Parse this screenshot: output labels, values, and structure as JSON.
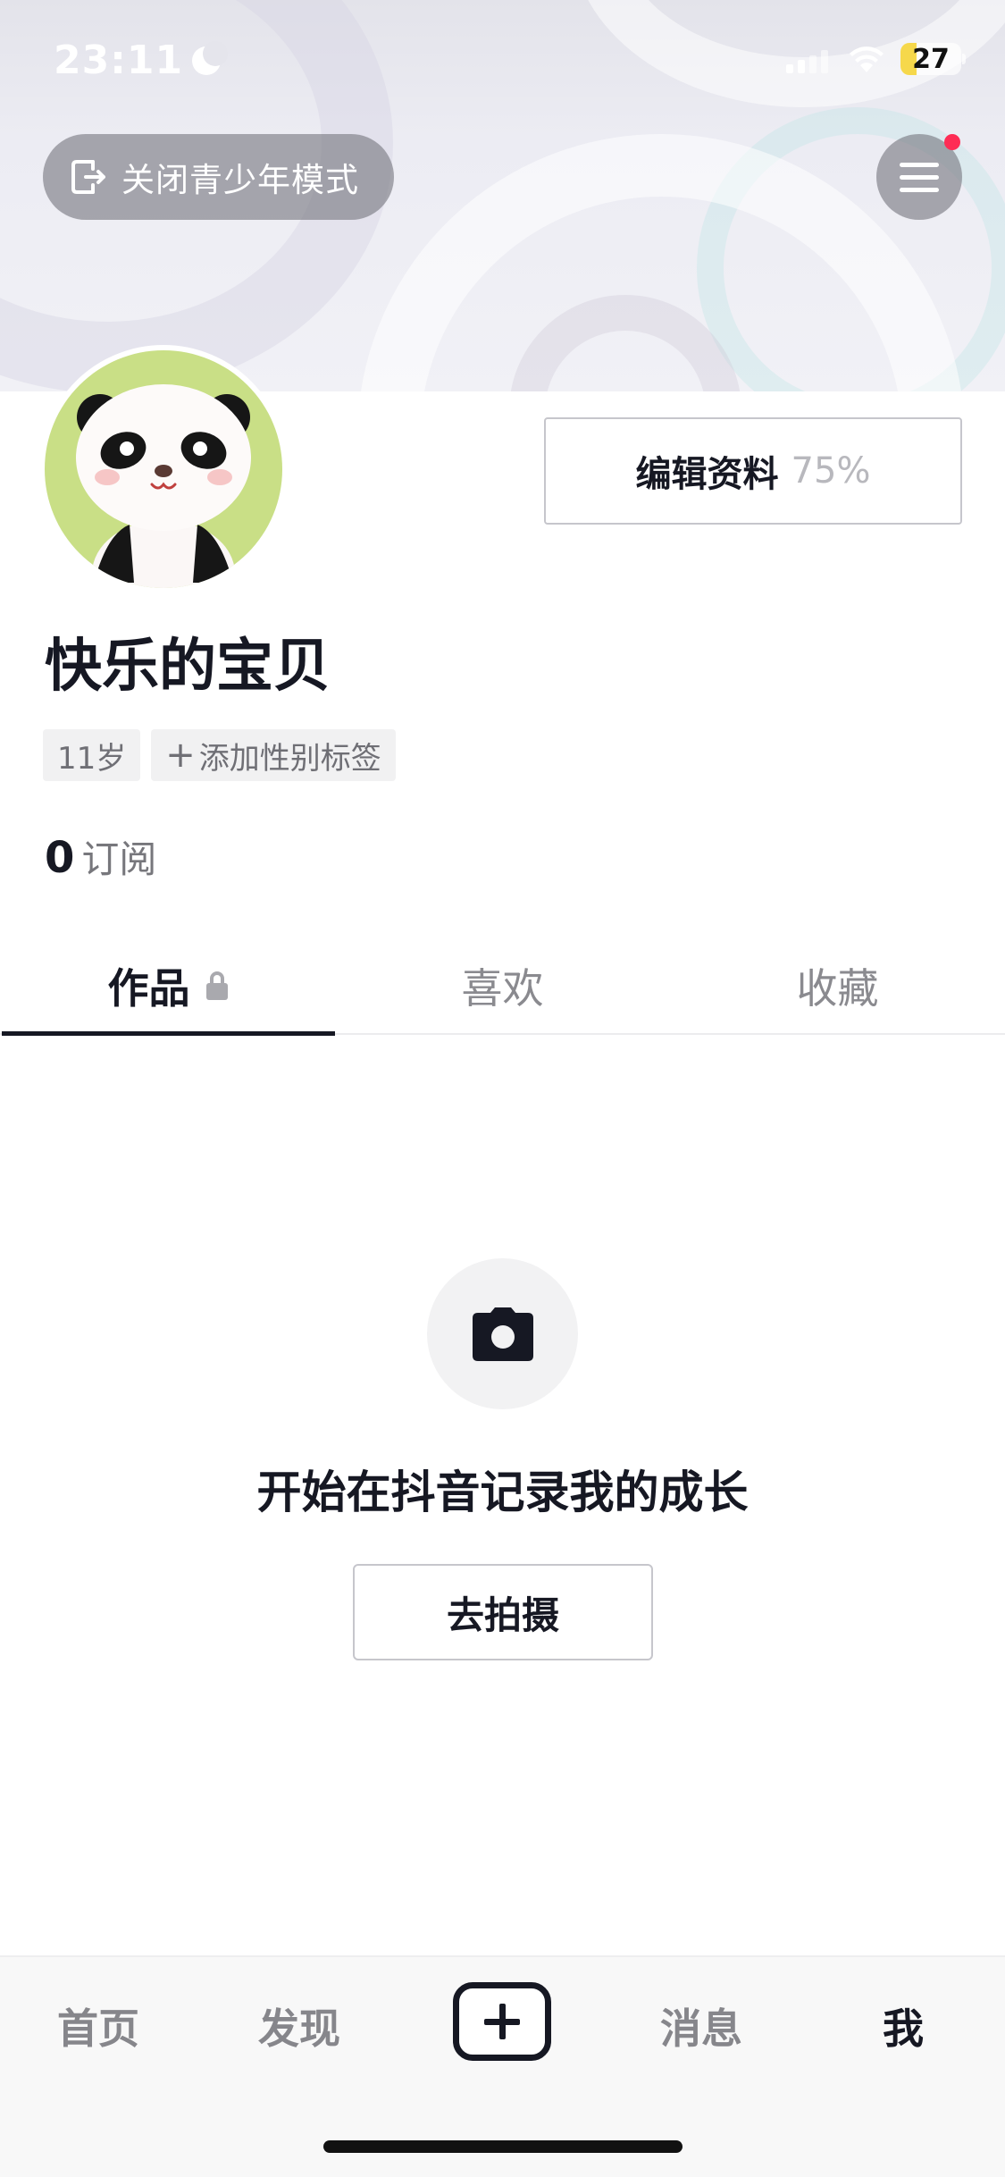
{
  "status_bar": {
    "time": "23:11",
    "battery": "27",
    "icons": [
      "moon-icon",
      "signal-icon",
      "wifi-icon",
      "battery-icon"
    ]
  },
  "header": {
    "teen_mode_label": "关闭青少年模式",
    "menu_icon": "hamburger-menu-icon",
    "has_notification_dot": true
  },
  "profile": {
    "edit_label": "编辑资料",
    "completion": "75%",
    "nickname": "快乐的宝贝",
    "tags": {
      "age": "11岁",
      "add_gender": "添加性别标签"
    },
    "subscriptions_count": "0",
    "subscriptions_label": "订阅"
  },
  "tabs": [
    {
      "label": "作品",
      "active": true,
      "locked": true
    },
    {
      "label": "喜欢",
      "active": false
    },
    {
      "label": "收藏",
      "active": false
    }
  ],
  "empty_state": {
    "icon": "camera-icon",
    "title": "开始在抖音记录我的成长",
    "button": "去拍摄"
  },
  "bottom_nav": {
    "home": "首页",
    "discover": "发现",
    "create_icon": "plus-icon",
    "messages": "消息",
    "me": "我",
    "active": "me"
  },
  "colors": {
    "text_primary": "#161823",
    "accent_red": "#fe2c55",
    "avatar_bg": "#c9df86",
    "battery_yellow": "#f6d84b"
  }
}
